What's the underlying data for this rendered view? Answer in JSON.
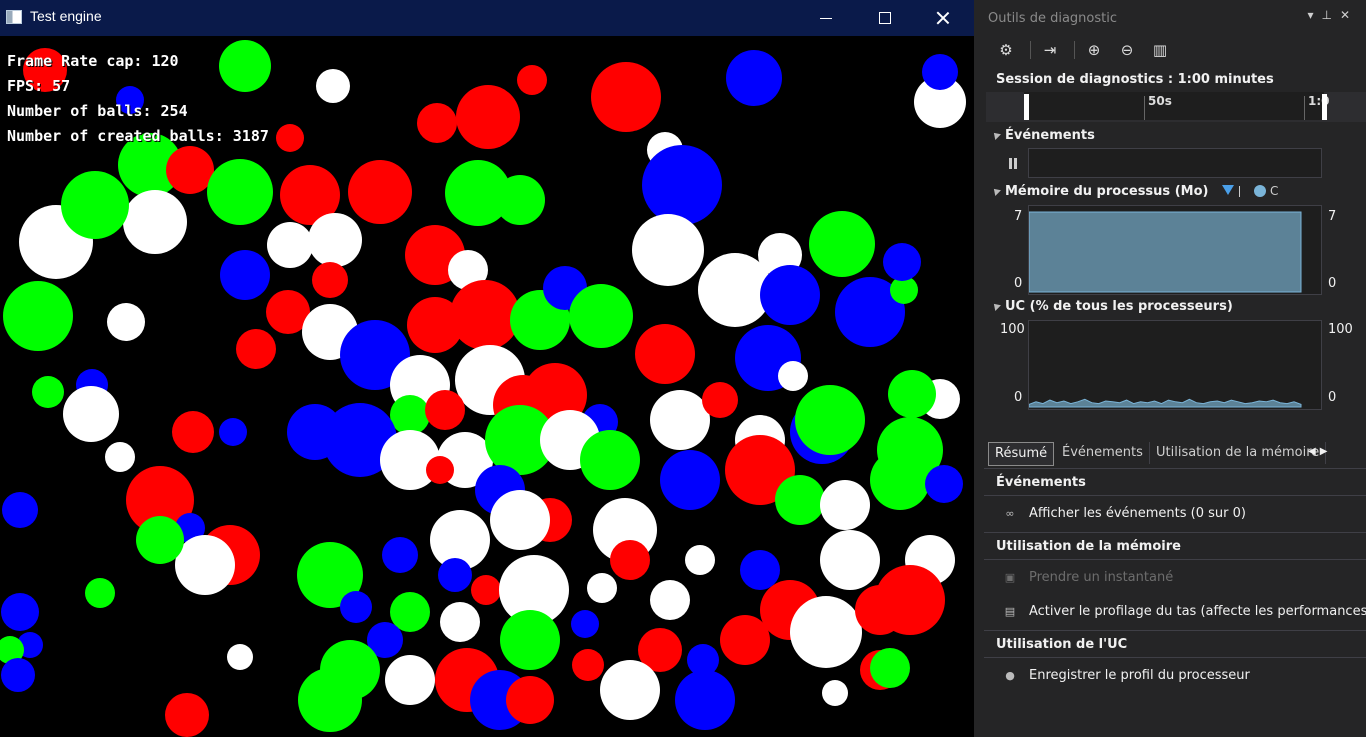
{
  "app_window": {
    "title": "Test engine",
    "hud": {
      "frame_rate_cap": "Frame Rate cap: 120",
      "fps": "FPS: 57",
      "number_of_balls": "Number of balls: 254",
      "number_of_created_balls": "Number of created balls: 3187"
    },
    "ball_colors": [
      "#ff0000",
      "#00ff00",
      "#0000ff",
      "#ffffff"
    ],
    "background_color": "#000000"
  },
  "diagnostics": {
    "title": "Outils de diagnostic",
    "toolbar_icons": [
      "gear-icon",
      "export-icon",
      "zoom-in-icon",
      "zoom-out-icon",
      "chart-icon"
    ],
    "session_label": "Session de diagnostics : 1:00 minutes",
    "timeline_labels": [
      "50s",
      "1:0"
    ],
    "events_section": "Événements",
    "memory_section": "Mémoire du processus (Mo)",
    "memory_axis": {
      "left_max": "7",
      "left_min": "0",
      "right_max": "7",
      "right_min": "0"
    },
    "memory_value_fraction": 0.93,
    "legend_truncated": [
      "I",
      "C"
    ],
    "cpu_section": "UC (% de tous les processeurs)",
    "cpu_axis": {
      "left_max": "100",
      "left_min": "0",
      "right_max": "100",
      "right_min": "0"
    },
    "cpu_series": [
      3,
      6,
      4,
      8,
      5,
      7,
      4,
      6,
      9,
      5,
      4,
      7,
      6,
      5,
      8,
      4,
      6,
      5,
      7,
      4,
      8,
      6,
      5,
      9,
      5,
      4,
      6,
      7,
      5,
      8,
      6,
      4,
      5,
      7,
      6,
      8,
      5,
      4,
      6,
      3
    ],
    "tabs": [
      "Résumé",
      "Événements",
      "Utilisation de la mémoire"
    ],
    "groups": {
      "events": {
        "title": "Événements",
        "items": [
          {
            "label": "Afficher les événements (0 sur 0)",
            "icon": "dots-icon"
          }
        ]
      },
      "memory": {
        "title": "Utilisation de la mémoire",
        "items": [
          {
            "label": "Prendre un instantané",
            "icon": "camera-icon",
            "disabled": true
          },
          {
            "label": "Activer le profilage du tas (affecte les performances)",
            "icon": "chip-icon"
          }
        ]
      },
      "cpu": {
        "title": "Utilisation de l'UC",
        "items": [
          {
            "label": "Enregistrer le profil du processeur",
            "icon": "record-icon"
          }
        ]
      }
    }
  }
}
